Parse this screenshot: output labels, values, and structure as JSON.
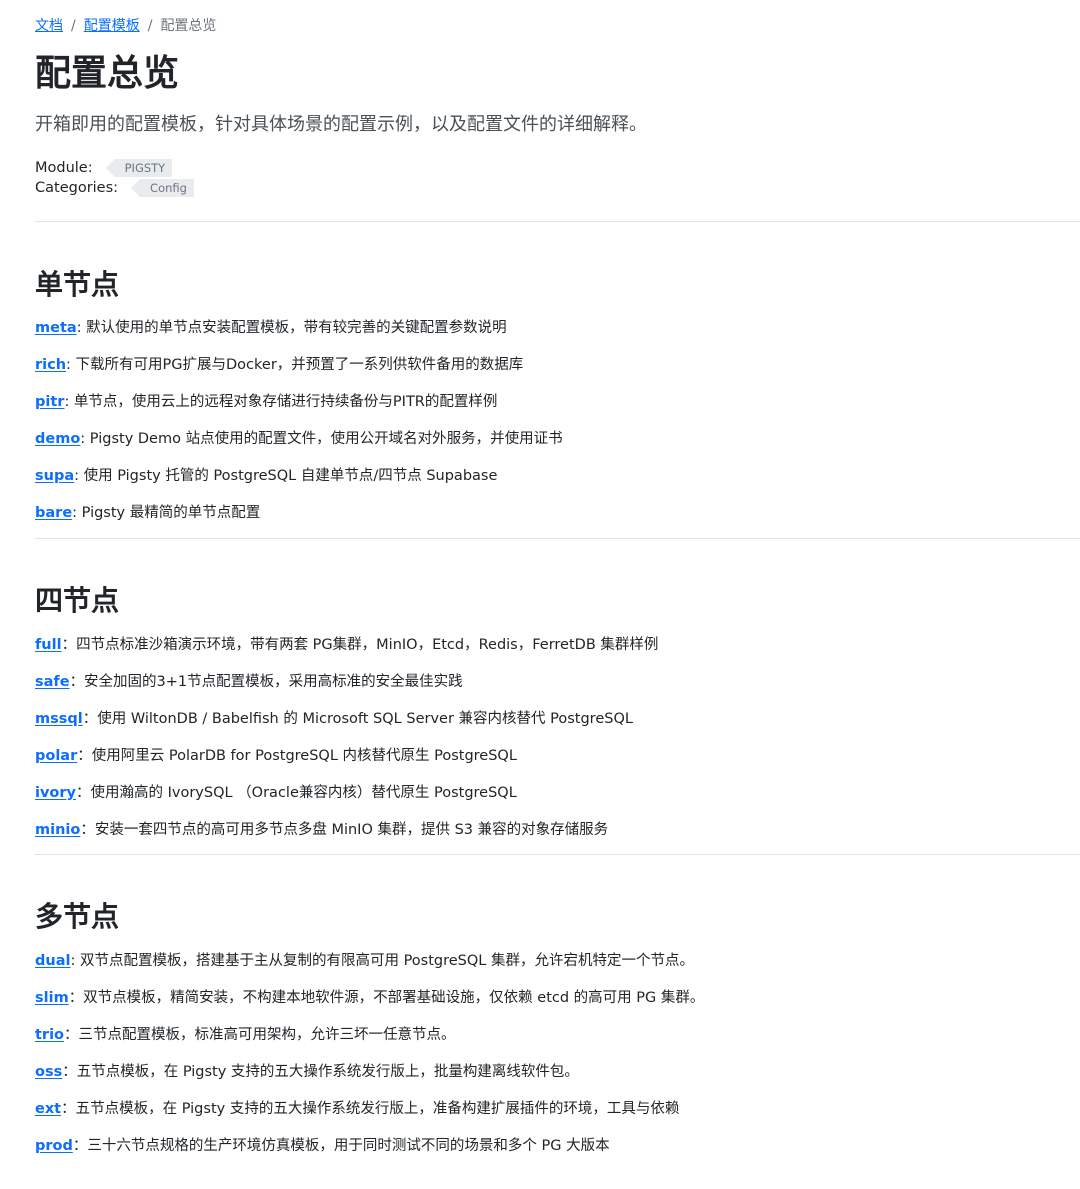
{
  "breadcrumb": {
    "items": [
      "文档",
      "配置模板"
    ],
    "separator": "/",
    "current": "配置总览"
  },
  "title": "配置总览",
  "lead": "开箱即用的配置模板，针对具体场景的配置示例，以及配置文件的详细解释。",
  "meta": {
    "module_label": "Module:",
    "module_tag": "PIGSTY",
    "categories_label": "Categories:",
    "categories_tag": "Config"
  },
  "sections": [
    {
      "heading": "单节点",
      "items": [
        {
          "name": "meta",
          "desc": ": 默认使用的单节点安装配置模板，带有较完善的关键配置参数说明"
        },
        {
          "name": "rich",
          "desc": ": 下载所有可用PG扩展与Docker，并预置了一系列供软件备用的数据库"
        },
        {
          "name": "pitr",
          "desc": ": 单节点，使用云上的远程对象存储进行持续备份与PITR的配置样例"
        },
        {
          "name": "demo",
          "desc": ": Pigsty Demo 站点使用的配置文件，使用公开域名对外服务，并使用证书"
        },
        {
          "name": "supa",
          "desc": ": 使用 Pigsty 托管的 PostgreSQL 自建单节点/四节点 Supabase"
        },
        {
          "name": "bare",
          "desc": ": Pigsty 最精简的单节点配置"
        }
      ]
    },
    {
      "heading": "四节点",
      "items": [
        {
          "name": "full",
          "desc": "：四节点标准沙箱演示环境，带有两套 PG集群，MinIO，Etcd，Redis，FerretDB 集群样例"
        },
        {
          "name": "safe",
          "desc": "：安全加固的3+1节点配置模板，采用高标准的安全最佳实践"
        },
        {
          "name": "mssql",
          "desc": "：使用 WiltonDB / Babelfish 的 Microsoft SQL Server 兼容内核替代 PostgreSQL"
        },
        {
          "name": "polar",
          "desc": "：使用阿里云 PolarDB for PostgreSQL 内核替代原生 PostgreSQL"
        },
        {
          "name": "ivory",
          "desc": "：使用瀚高的 IvorySQL （Oracle兼容内核）替代原生 PostgreSQL"
        },
        {
          "name": "minio",
          "desc": "：安装一套四节点的高可用多节点多盘 MinIO 集群，提供 S3 兼容的对象存储服务"
        }
      ]
    },
    {
      "heading": "多节点",
      "items": [
        {
          "name": "dual",
          "desc": ": 双节点配置模板，搭建基于主从复制的有限高可用 PostgreSQL 集群，允许宕机特定一个节点。"
        },
        {
          "name": "slim",
          "desc": "：双节点模板，精简安装，不构建本地软件源，不部署基础设施，仅依赖 etcd 的高可用 PG 集群。"
        },
        {
          "name": "trio",
          "desc": "：三节点配置模板，标准高可用架构，允许三坏一任意节点。"
        },
        {
          "name": "oss",
          "desc": "：五节点模板，在 Pigsty 支持的五大操作系统发行版上，批量构建离线软件包。"
        },
        {
          "name": "ext",
          "desc": "：五节点模板，在 Pigsty 支持的五大操作系统发行版上，准备构建扩展插件的环境，工具与依赖"
        },
        {
          "name": "prod",
          "desc": "：三十六节点规格的生产环境仿真模板，用于同时测试不同的场景和多个 PG 大版本"
        }
      ]
    }
  ]
}
